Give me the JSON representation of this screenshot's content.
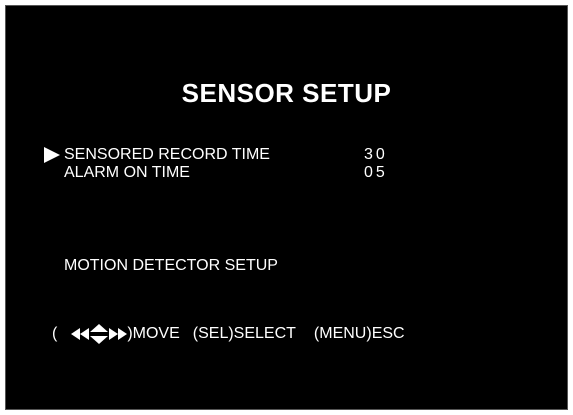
{
  "title": "SENSOR SETUP",
  "menu": {
    "items": [
      {
        "label": "SENSORED RECORD TIME",
        "value": "30",
        "selected": true
      },
      {
        "label": "ALARM ON TIME",
        "value": "05",
        "selected": false
      }
    ],
    "submenu_label": "MOTION DETECTOR SETUP"
  },
  "footer": {
    "open_paren": "(",
    "move_label": ")MOVE",
    "select_label": "(SEL)SELECT",
    "esc_label": "(MENU)ESC",
    "nav_icon": "arrow-keys-icon"
  },
  "colors": {
    "background": "#000000",
    "text": "#ffffff"
  }
}
